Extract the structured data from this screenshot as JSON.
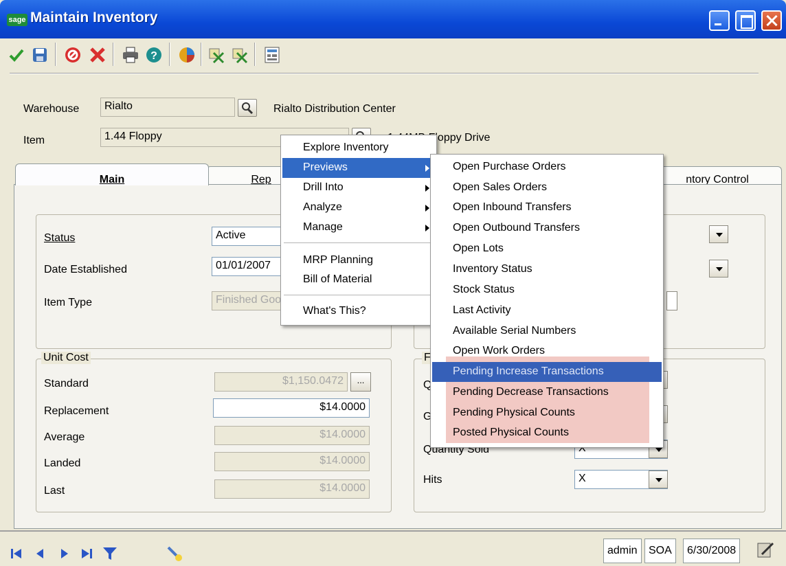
{
  "window": {
    "title": "Maintain Inventory",
    "logo_text": "sage"
  },
  "toolbar": {
    "buttons": [
      {
        "name": "accept",
        "icon": "check-icon"
      },
      {
        "name": "save",
        "icon": "save-icon"
      },
      {
        "name": "delete",
        "icon": "delete-icon"
      },
      {
        "name": "cancel",
        "icon": "cancel-icon"
      },
      {
        "name": "print",
        "icon": "print-icon"
      },
      {
        "name": "help",
        "icon": "help-icon"
      },
      {
        "name": "explore",
        "icon": "explore-icon"
      },
      {
        "name": "attach",
        "icon": "attach-icon"
      },
      {
        "name": "view1",
        "icon": "grid-icon"
      },
      {
        "name": "view2",
        "icon": "grid-icon"
      },
      {
        "name": "notes",
        "icon": "notes-icon"
      }
    ]
  },
  "header": {
    "warehouse_label": "Warehouse",
    "warehouse_value": "Rialto",
    "warehouse_desc": "Rialto Distribution Center",
    "item_label": "Item",
    "item_value": "1.44 Floppy",
    "item_desc": "1.44MB Floppy Drive"
  },
  "tabs": [
    {
      "label": "Main",
      "active": true
    },
    {
      "label": "Rep"
    },
    {
      "label": "ntory Control"
    }
  ],
  "main": {
    "status_label": "Status",
    "status_value": "Active",
    "date_label": "Date Established",
    "date_value": "01/01/2007",
    "item_type_label": "Item Type",
    "item_type_value": "Finished Goods",
    "unit_cost": {
      "title": "Unit Cost",
      "rows": [
        {
          "label": "Standard",
          "value": "$1,150.0472",
          "readonly": true
        },
        {
          "label": "Replacement",
          "value": "$14.0000",
          "readonly": false
        },
        {
          "label": "Average",
          "value": "$14.0000",
          "readonly": true
        },
        {
          "label": "Landed",
          "value": "$14.0000",
          "readonly": true
        },
        {
          "label": "Last",
          "value": "$14.0000",
          "readonly": true
        }
      ]
    },
    "right_group": {
      "title": "F",
      "row1_label": "Q",
      "row2_label": "G",
      "quantity_sold_label": "Quantity Sold",
      "quantity_sold_value": "X",
      "hits_label": "Hits",
      "hits_value": "X"
    }
  },
  "context_menu": {
    "items": [
      {
        "label": "Explore Inventory",
        "submenu": false
      },
      {
        "label": "Previews",
        "submenu": true,
        "highlighted": true
      },
      {
        "label": "Drill Into",
        "submenu": true
      },
      {
        "label": "Analyze",
        "submenu": true
      },
      {
        "label": "Manage",
        "submenu": true
      },
      {
        "label": "MRP Planning",
        "submenu": false
      },
      {
        "label": "Bill of Material",
        "submenu": false
      },
      {
        "label": "What's This?",
        "submenu": false
      }
    ]
  },
  "previews_submenu": {
    "items": [
      "Open Purchase Orders",
      "Open Sales Orders",
      "Open Inbound Transfers",
      "Open Outbound Transfers",
      "Open Lots",
      "Inventory Status",
      "Stock Status",
      "Last Activity",
      "Available Serial Numbers",
      "Open Work Orders",
      "Pending Increase Transactions",
      "Pending Decrease Transactions",
      "Pending Physical Counts",
      "Posted Physical Counts"
    ],
    "highlighted_index": 10,
    "accent_highlight_color": "#f2c9c4",
    "selection_color": "#316ac5"
  },
  "statusbar": {
    "user": "admin",
    "company": "SOA",
    "date": "6/30/2008"
  }
}
